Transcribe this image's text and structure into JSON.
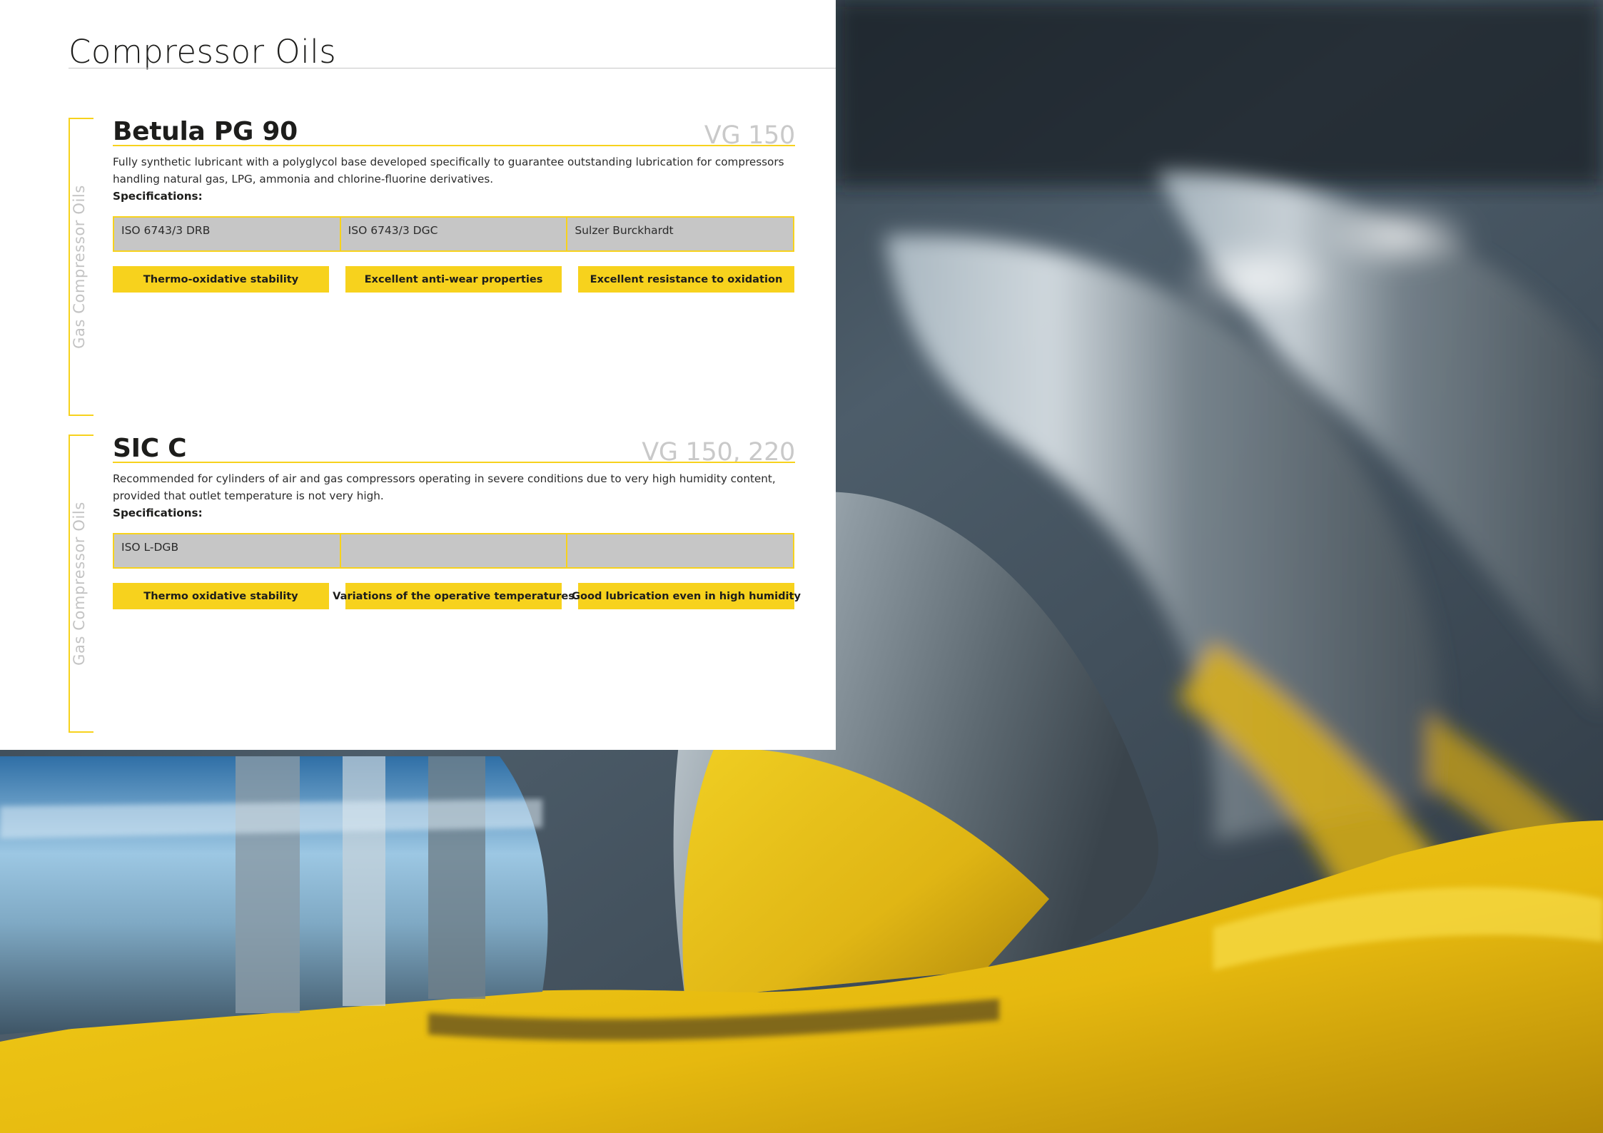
{
  "page": {
    "title": "Compressor Oils"
  },
  "theme": {
    "accent_yellow": "#f7d21d",
    "spec_gray": "#c6c6c6",
    "muted_text": "#c3c3c3"
  },
  "products": [
    {
      "category_label": "Gas Compressor Oils",
      "name": "Betula PG 90",
      "viscosity_grade": "VG 150",
      "description": "Fully synthetic lubricant with a polyglycol base developed specifically to guarantee outstanding lubrication for compressors handling natural gas, LPG, ammonia and chlorine-fluorine derivatives.",
      "specifications_label": "Specifications:",
      "specifications": [
        "ISO 6743/3 DRB",
        "ISO 6743/3 DGC",
        "Sulzer Burckhardt"
      ],
      "features": [
        "Thermo-oxidative stability",
        "Excellent anti-wear properties",
        "Excellent resistance to oxidation"
      ]
    },
    {
      "category_label": "Gas Compressor Oils",
      "name": "SIC C",
      "viscosity_grade": "VG 150, 220",
      "description": "Recommended for cylinders of air and gas compressors operating in severe conditions due to very high humidity content, provided that outlet temperature is not very high.",
      "specifications_label": "Specifications:",
      "specifications": [
        "ISO L-DGB",
        "",
        ""
      ],
      "features": [
        "Thermo oxidative stability",
        "Variations of the operative temperatures",
        "Good lubrication even in high humidity"
      ]
    }
  ]
}
